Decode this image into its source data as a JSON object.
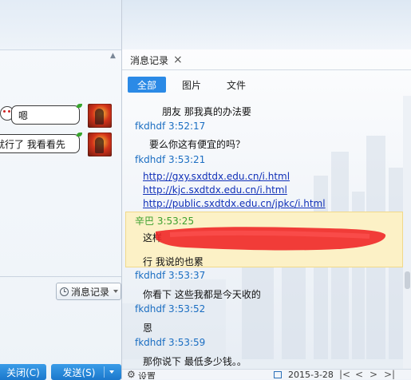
{
  "left_chat": {
    "messages": [
      {
        "text": "嗯"
      },
      {
        "text": "就行了 我看看先"
      }
    ],
    "msg_record_button": "消息记录",
    "close_button": "关闭(C)",
    "send_button": "发送(S)"
  },
  "history_panel": {
    "tab_title": "消息记录",
    "filter_tabs": [
      "全部",
      "图片",
      "文件"
    ],
    "entries": [
      {
        "kind": "body",
        "text": "朋友 那我真的办法要"
      },
      {
        "kind": "sender",
        "text": "fkdhdf 3:52:17"
      },
      {
        "kind": "body",
        "text": "要么你这有便宜的吗？"
      },
      {
        "kind": "sender",
        "text": "fkdhdf 3:53:21"
      },
      {
        "kind": "link",
        "text": "http://gxy.sxdtdx.edu.cn/i.html"
      },
      {
        "kind": "link",
        "text": "http://kjc.sxdtdx.edu.cn/i.html"
      },
      {
        "kind": "link",
        "text": "http://public.sxdtdx.edu.cn/jpkc/i.html"
      },
      {
        "kind": "self_sender",
        "text": "辛巴 3:53:25"
      },
      {
        "kind": "body",
        "text": "这样"
      },
      {
        "kind": "body",
        "text": "行   我说的也累"
      },
      {
        "kind": "sender",
        "text": "fkdhdf 3:53:37"
      },
      {
        "kind": "body",
        "text": "你看下 这些我都是今天收的"
      },
      {
        "kind": "sender",
        "text": "fkdhdf 3:53:52"
      },
      {
        "kind": "body",
        "text": "恩"
      },
      {
        "kind": "sender",
        "text": "fkdhdf 3:53:59"
      },
      {
        "kind": "body",
        "text": "那你说下 最低多少钱。。"
      }
    ],
    "bottom_bar": {
      "settings_label": "设置",
      "date_label": "2015-3-28"
    }
  },
  "colors": {
    "accent_blue": "#2b8ae6",
    "sender_blue": "#1b6ec2",
    "self_green": "#3ca02f",
    "link_blue": "#1030b8",
    "highlight_yellow": "#fcf1c6",
    "redaction_red": "#f02828"
  }
}
